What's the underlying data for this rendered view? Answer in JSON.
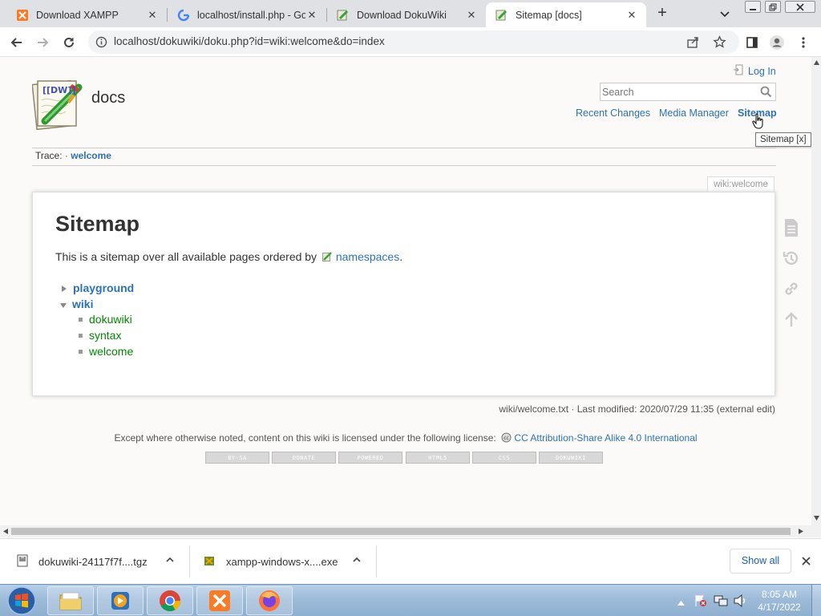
{
  "tabs": [
    {
      "title": "Download XAMPP",
      "icon": "xampp-icon",
      "active": false
    },
    {
      "title": "localhost/install.php - Go",
      "icon": "google-icon",
      "active": false
    },
    {
      "title": "Download DokuWiki",
      "icon": "dokuwiki-icon",
      "active": false
    },
    {
      "title": "Sitemap [docs]",
      "icon": "dokuwiki-icon",
      "active": true
    }
  ],
  "address_bar": {
    "url": "localhost/dokuwiki/doku.php?id=wiki:welcome&do=index"
  },
  "wiki": {
    "site_title": "docs",
    "logo_text": "[[DW]]",
    "login_label": "Log In",
    "search_placeholder": "Search",
    "nav": {
      "recent_changes": "Recent Changes",
      "media_manager": "Media Manager",
      "sitemap": "Sitemap"
    },
    "tooltip": "Sitemap [x]",
    "trace_label": "Trace:",
    "trace_sep": "·",
    "trace_item": "welcome",
    "page_id": "wiki:welcome",
    "heading": "Sitemap",
    "intro_text": "This is a sitemap over all available pages ordered by",
    "intro_link": "namespaces",
    "intro_end": ".",
    "tree": {
      "playground": "playground",
      "wiki": "wiki",
      "wiki_pages": [
        "dokuwiki",
        "syntax",
        "welcome"
      ]
    },
    "doc_info": "wiki/welcome.txt · Last modified: 2020/07/29 11:35 (external edit)",
    "license_text": "Except where otherwise noted, content on this wiki is licensed under the following license:",
    "license_link": "CC Attribution-Share Alike 4.0 International",
    "badges": [
      "BY-SA",
      "DONATE",
      "POWERED",
      "HTML5",
      "CSS",
      "DOKUWIKI"
    ]
  },
  "downloads": {
    "items": [
      {
        "name": "dokuwiki-24117f7f....tgz"
      },
      {
        "name": "xampp-windows-x....exe"
      }
    ],
    "show_all": "Show all"
  },
  "taskbar": {
    "time": "8:05 AM",
    "date": "4/17/2022"
  },
  "colors": {
    "link": "#2b73b7",
    "page_link": "#008800",
    "tab_strip": "#dfe1e5",
    "page_bg": "#fbfaf9"
  }
}
